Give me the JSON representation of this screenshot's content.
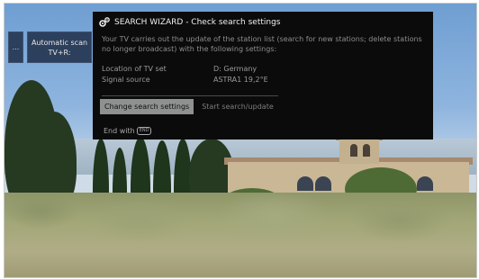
{
  "side_menu": {
    "stub_label": "...",
    "item_label": "Automatic scan TV+R:"
  },
  "dialog": {
    "title": "SEARCH WIZARD - Check search settings",
    "icon": "gear-icon",
    "description": "Your TV carries out the update of the station list (search for new stations; delete stations no longer broadcast) with the following settings:",
    "settings": [
      {
        "label": "Location of TV set",
        "value": "D: Germany"
      },
      {
        "label": "Signal source",
        "value": "ASTRA1 19,2°E"
      }
    ],
    "buttons": {
      "change": "Change search settings",
      "start": "Start search/update"
    },
    "end": {
      "prefix": "End with",
      "key_label": "END"
    }
  },
  "colors": {
    "dialog_background": "#0b0b0b",
    "selected_button": "#8f9090",
    "menu_background": "#2c3f5c"
  }
}
